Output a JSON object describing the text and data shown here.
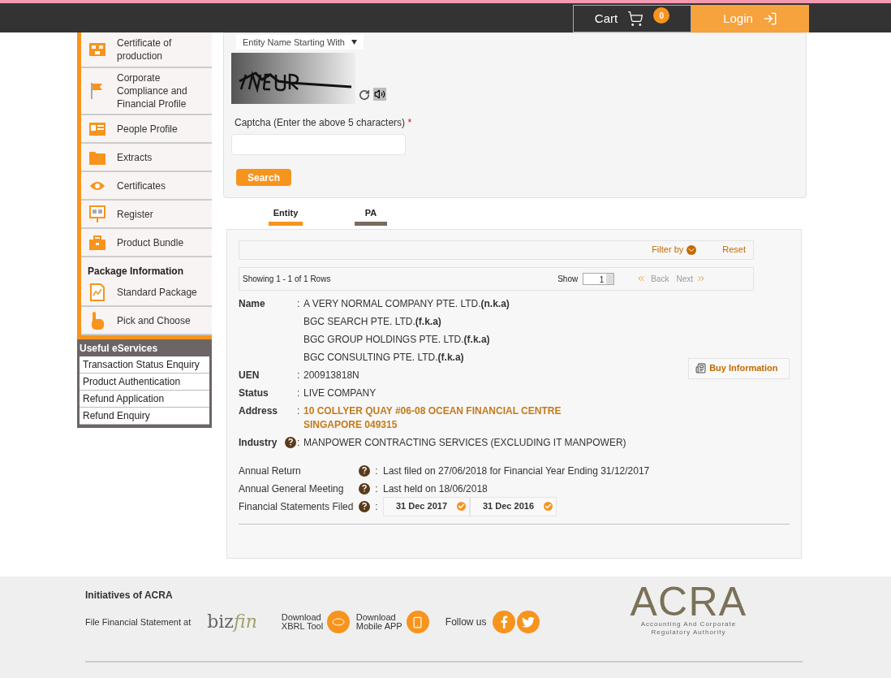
{
  "header": {
    "cart": {
      "label": "Cart",
      "count": "0"
    },
    "login": "Login"
  },
  "sidebar": {
    "items": [
      {
        "kind": "orgchart",
        "label": "Certificate of production"
      },
      {
        "kind": "flag",
        "label": "Corporate Compliance and Financial Profile"
      },
      {
        "kind": "people",
        "label": "People Profile"
      },
      {
        "kind": "folder",
        "label": "Extracts"
      },
      {
        "kind": "eye",
        "label": "Certificates"
      },
      {
        "kind": "board",
        "label": "Register"
      },
      {
        "kind": "briefcase",
        "label": "Product Bundle"
      }
    ],
    "package_heading": "Package Information",
    "package_items": [
      {
        "kind": "doc",
        "label": "Standard Package"
      },
      {
        "kind": "hand",
        "label": "Pick and Choose"
      }
    ],
    "eservices_heading": "Useful eServices",
    "eservices": [
      "Transaction Status Enquiry",
      "Product Authentication",
      "Refund Application",
      "Refund Enquiry"
    ]
  },
  "search_form": {
    "search_type": "Entity Name Starting With",
    "captcha_label": "Captcha (Enter the above 5 characters)",
    "required_mark": "*",
    "search_button": "Search"
  },
  "tabs": [
    {
      "label": "Entity",
      "selected": true
    },
    {
      "label": "PA",
      "selected": false
    }
  ],
  "results": {
    "separator": ":",
    "filter_by": "Filter by",
    "reset": "Reset",
    "showing": "Showing 1 - 1 of 1 Rows",
    "show_label": "Show",
    "show_value": "1",
    "back": "Back",
    "next": "Next",
    "buy_information": "Buy Information",
    "details": [
      {
        "label": "Name",
        "help": false,
        "values": [
          "A VERY NORMAL COMPANY PTE. LTD.**(n.k.a)**",
          "BGC SEARCH PTE. LTD.**(f.k.a)**",
          "BGC GROUP HOLDINGS PTE. LTD.**(f.k.a)**",
          "BGC CONSULTING PTE. LTD.**(f.k.a)**"
        ],
        "kind": "text"
      },
      {
        "label": "UEN",
        "help": false,
        "values": [
          "200913818N"
        ],
        "kind": "text"
      },
      {
        "label": "Status",
        "help": false,
        "values": [
          "LIVE COMPANY"
        ],
        "kind": "text"
      },
      {
        "label": "Address",
        "help": false,
        "values": [
          "10 COLLYER QUAY #06-08 OCEAN FINANCIAL CENTRE SINGAPORE 049315"
        ],
        "kind": "link"
      },
      {
        "label": "Industry",
        "help": true,
        "values": [
          "MANPOWER CONTRACTING SERVICES (EXCLUDING IT MANPOWER)"
        ],
        "kind": "text"
      }
    ],
    "filings": [
      {
        "label": "Annual Return",
        "kind": "text",
        "value": "Last filed on 27/06/2018 for Financial Year Ending 31/12/2017"
      },
      {
        "label": "Annual General Meeting",
        "kind": "text",
        "value": "Last held on 18/06/2018"
      },
      {
        "label": "Financial Statements Filed",
        "kind": "chips",
        "chips": [
          "31 Dec 2017",
          "31 Dec 2016"
        ]
      }
    ]
  },
  "footer": {
    "heading": "Initiatives of ACRA",
    "file_statement": "File Financial Statement at",
    "bizfin": [
      "biz",
      "fin"
    ],
    "xbrl": "Download XBRL Tool",
    "mobile": "Download Mobile APP",
    "follow": "Follow us",
    "acra": "ACRA",
    "acra_sub": "Accounting And Corporate Regulatory Authority"
  }
}
